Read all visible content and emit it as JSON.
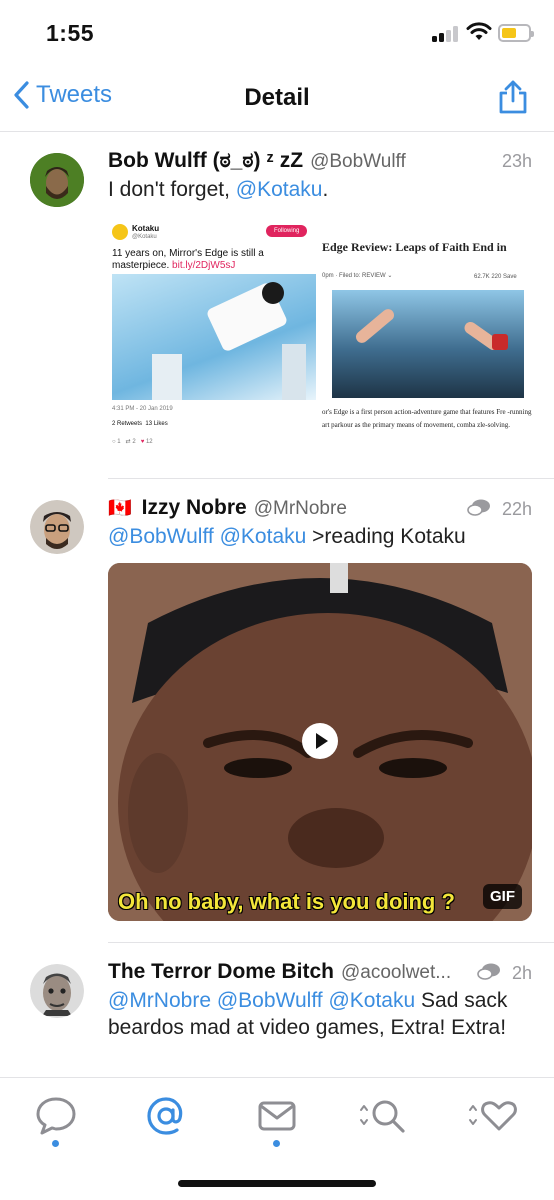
{
  "status_bar": {
    "time": "1:55"
  },
  "navbar": {
    "back_label": "Tweets",
    "title": "Detail"
  },
  "tweets": [
    {
      "name": "Bob Wulff (ಠ_ಠ) ᶻ zZ",
      "handle": "@BobWulff",
      "time": "23h",
      "text_plain": "I don't forget, ",
      "text_mention": "@Kotaku",
      "text_end": ".",
      "media": {
        "embedded_tweet": {
          "account": "Kotaku",
          "account_handle": "@Kotaku",
          "follow_label": "Following",
          "text": "11 years on, Mirror's Edge is still a masterpiece.",
          "link": "bit.ly/2DjW5sJ",
          "timestamp": "4:31 PM - 20 Jan 2019",
          "retweets": "2 Retweets",
          "likes": "13 Likes",
          "reply_count": "1",
          "rt_count": "2",
          "heart_count": "12"
        },
        "article": {
          "headline": "Edge Review: Leaps of Faith End in",
          "meta": "0pm · Filed to: REVIEW ⌄",
          "stats": "62.7K  220  Save",
          "body": "or's Edge is a first person action-adventure game that features Fre -running art parkour as the primary means of movement, comba zle-solving."
        }
      }
    },
    {
      "flag": "🇨🇦",
      "name": "Izzy Nobre",
      "handle": "@MrNobre",
      "time": "22h",
      "mentions": [
        "@BobWulff",
        "@Kotaku"
      ],
      "text_plain": ">reading Kotaku",
      "media": {
        "caption": "Oh no baby, what is you doing ?",
        "badge": "GIF"
      }
    },
    {
      "name": "The Terror Dome Bitch",
      "handle": "@acoolwet...",
      "time": "2h",
      "mentions": [
        "@MrNobre",
        "@BobWulff",
        "@Kotaku"
      ],
      "text_plain": "Sad sack beardos mad at video games, Extra! Extra!"
    }
  ],
  "tabbar": {
    "tabs": [
      {
        "name": "timeline",
        "icon": "speech-bubble-icon",
        "selected": false,
        "dot": true
      },
      {
        "name": "mentions",
        "icon": "at-sign-icon",
        "selected": true,
        "dot": false
      },
      {
        "name": "messages",
        "icon": "envelope-icon",
        "selected": false,
        "dot": true
      },
      {
        "name": "search",
        "icon": "search-icon",
        "selected": false,
        "dot": false
      },
      {
        "name": "favorites",
        "icon": "heart-icon",
        "selected": false,
        "dot": false
      }
    ]
  },
  "colors": {
    "accent": "#3b8de0",
    "text": "#111111",
    "secondary": "#666666"
  }
}
